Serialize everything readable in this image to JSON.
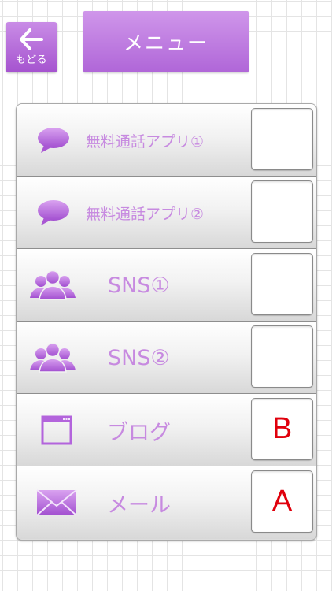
{
  "header": {
    "back_label": "もどる",
    "title": "メニュー"
  },
  "accent_color": "#b066d8",
  "marker_color": "#e0000c",
  "rows": [
    {
      "label": "無料通話アプリ①",
      "icon": "speech-bubble-icon",
      "slot": ""
    },
    {
      "label": "無料通話アプリ②",
      "icon": "speech-bubble-icon",
      "slot": ""
    },
    {
      "label": "SNS①",
      "icon": "people-group-icon",
      "slot": ""
    },
    {
      "label": "SNS②",
      "icon": "people-group-icon",
      "slot": ""
    },
    {
      "label": "ブログ",
      "icon": "browser-window-icon",
      "slot": "B"
    },
    {
      "label": "メール",
      "icon": "envelope-icon",
      "slot": "A"
    }
  ]
}
